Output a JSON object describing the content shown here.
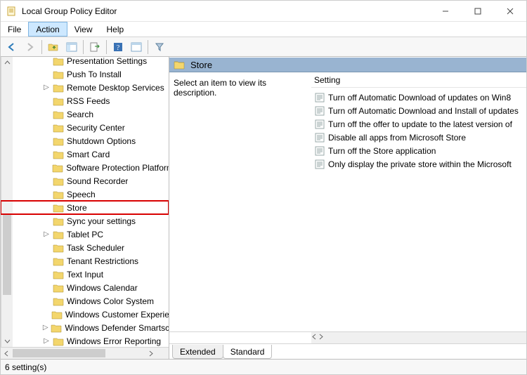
{
  "window_title": "Local Group Policy Editor",
  "menu": [
    "File",
    "Action",
    "View",
    "Help"
  ],
  "menu_selected": 1,
  "tree": [
    {
      "level": 4,
      "label": "Presentation Settings",
      "expander": ""
    },
    {
      "level": 4,
      "label": "Push To Install",
      "expander": ""
    },
    {
      "level": 4,
      "label": "Remote Desktop Services",
      "expander": ">"
    },
    {
      "level": 4,
      "label": "RSS Feeds",
      "expander": ""
    },
    {
      "level": 4,
      "label": "Search",
      "expander": ""
    },
    {
      "level": 4,
      "label": "Security Center",
      "expander": ""
    },
    {
      "level": 4,
      "label": "Shutdown Options",
      "expander": ""
    },
    {
      "level": 4,
      "label": "Smart Card",
      "expander": ""
    },
    {
      "level": 4,
      "label": "Software Protection Platform",
      "expander": ""
    },
    {
      "level": 4,
      "label": "Sound Recorder",
      "expander": ""
    },
    {
      "level": 4,
      "label": "Speech",
      "expander": ""
    },
    {
      "level": 4,
      "label": "Store",
      "expander": "",
      "highlight": true
    },
    {
      "level": 4,
      "label": "Sync your settings",
      "expander": ""
    },
    {
      "level": 4,
      "label": "Tablet PC",
      "expander": ">"
    },
    {
      "level": 4,
      "label": "Task Scheduler",
      "expander": ""
    },
    {
      "level": 4,
      "label": "Tenant Restrictions",
      "expander": ""
    },
    {
      "level": 4,
      "label": "Text Input",
      "expander": ""
    },
    {
      "level": 4,
      "label": "Windows Calendar",
      "expander": ""
    },
    {
      "level": 4,
      "label": "Windows Color System",
      "expander": ""
    },
    {
      "level": 4,
      "label": "Windows Customer Experience",
      "expander": ""
    },
    {
      "level": 4,
      "label": "Windows Defender Smartscreen",
      "expander": ">"
    },
    {
      "level": 4,
      "label": "Windows Error Reporting",
      "expander": ">"
    }
  ],
  "right_header": "Store",
  "description_prompt": "Select an item to view its description.",
  "list_header": "Setting",
  "settings": [
    "Turn off Automatic Download of updates on Win8",
    "Turn off Automatic Download and Install of updates",
    "Turn off the offer to update to the latest version of",
    "Disable all apps from Microsoft Store",
    "Turn off the Store application",
    "Only display the private store within the Microsoft"
  ],
  "tabs": [
    "Extended",
    "Standard"
  ],
  "active_tab": 1,
  "status": "6 setting(s)"
}
